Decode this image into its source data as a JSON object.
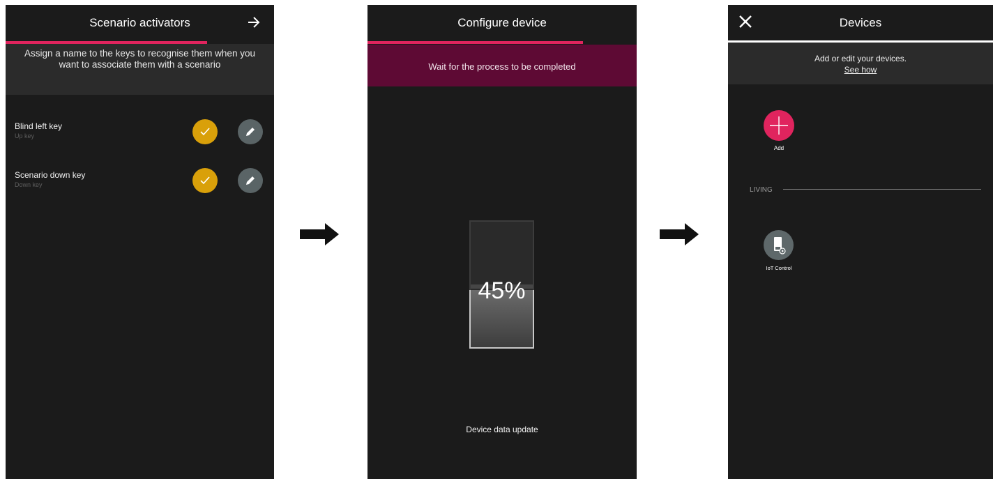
{
  "screen1": {
    "title": "Scenario activators",
    "progress": 0.75,
    "info": "Assign a name to the keys to recognise them when you want to associate them with a scenario",
    "keys": [
      {
        "name": "Blind left key",
        "sub": "Up key"
      },
      {
        "name": "Scenario down key",
        "sub": "Down key"
      }
    ]
  },
  "screen2": {
    "title": "Configure device",
    "progress": 0.8,
    "info": "Wait for the process to be completed",
    "percent": "45%",
    "status": "Device data update"
  },
  "screen3": {
    "title": "Devices",
    "info": "Add or edit your devices.",
    "link": "See how",
    "add_label": "Add",
    "section": "LIVING",
    "device_label": "IoT Control"
  },
  "colors": {
    "accent": "#e0245e",
    "check": "#d9a00a",
    "banner": "#5e0a34",
    "background": "#1b1b1b"
  }
}
